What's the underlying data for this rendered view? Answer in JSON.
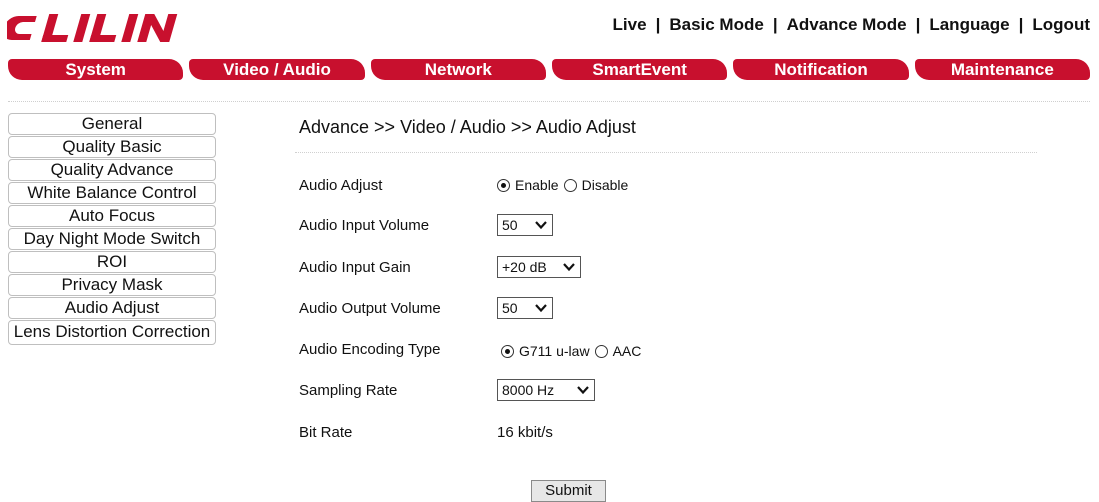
{
  "brand": {
    "logo_text": "LILIN",
    "color": "#c8102e"
  },
  "topnav": {
    "live": "Live",
    "basic_mode": "Basic Mode",
    "advance_mode": "Advance Mode",
    "language": "Language",
    "logout": "Logout",
    "separator": "|"
  },
  "tabs": [
    "System",
    "Video / Audio",
    "Network",
    "SmartEvent",
    "Notification",
    "Maintenance"
  ],
  "sidebar": [
    "General",
    "Quality Basic",
    "Quality Advance",
    "White Balance Control",
    "Auto Focus",
    "Day Night Mode Switch",
    "ROI",
    "Privacy Mask",
    "Audio Adjust",
    "Lens Distortion Correction"
  ],
  "breadcrumb": "Advance >> Video / Audio >> Audio Adjust",
  "form": {
    "audio_adjust": {
      "label": "Audio Adjust",
      "options": [
        "Enable",
        "Disable"
      ],
      "selected": "Enable"
    },
    "input_volume": {
      "label": "Audio Input Volume",
      "value": "50"
    },
    "input_gain": {
      "label": "Audio Input Gain",
      "value": "+20 dB"
    },
    "output_volume": {
      "label": "Audio Output Volume",
      "value": "50"
    },
    "encoding": {
      "label": "Audio Encoding Type",
      "options": [
        "G711 u-law",
        "AAC"
      ],
      "selected": "G711 u-law"
    },
    "sampling": {
      "label": "Sampling Rate",
      "value": "8000 Hz"
    },
    "bitrate": {
      "label": "Bit Rate",
      "value": "16 kbit/s"
    }
  },
  "submit_label": "Submit",
  "icons": {
    "dropdown": "chevron-down-icon",
    "logo": "lilin-logo-icon"
  }
}
